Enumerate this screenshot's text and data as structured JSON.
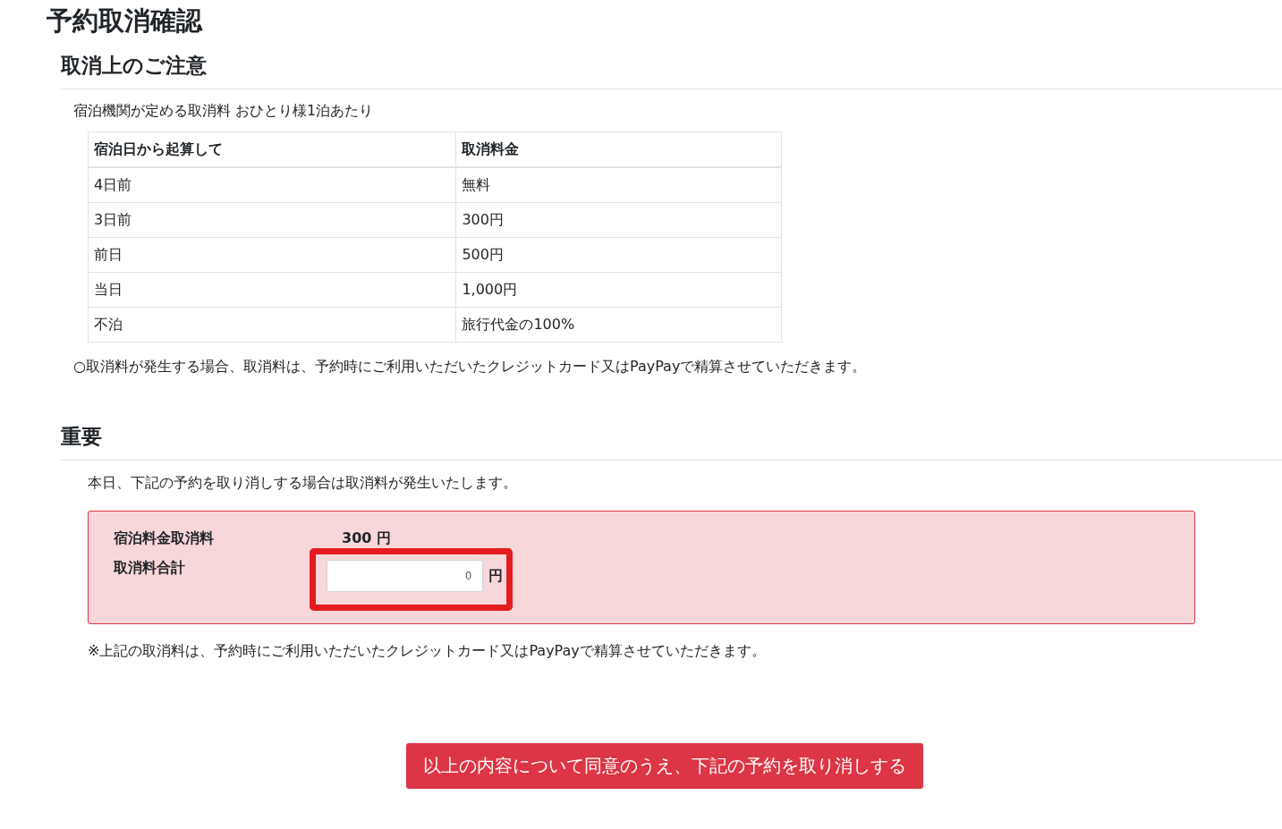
{
  "title": "予約取消確認",
  "notice": {
    "heading": "取消上のご注意",
    "intro": "宿泊機関が定める取消料  おひとり様1泊あたり",
    "table": {
      "columns": [
        "宿泊日から起算して",
        "取消料金"
      ],
      "rows": [
        [
          "4日前",
          "無料"
        ],
        [
          "3日前",
          "300円"
        ],
        [
          "前日",
          "500円"
        ],
        [
          "当日",
          "1,000円"
        ],
        [
          "不泊",
          "旅行代金の100%"
        ]
      ]
    },
    "note": "○取消料が発生する場合、取消料は、予約時にご利用いただいたクレジットカード又はPayPayで精算させていただきます。"
  },
  "important": {
    "heading": "重要",
    "message": "本日、下記の予約を取り消しする場合は取消料が発生いたします。",
    "fee_label": "宿泊料金取消料",
    "fee_value": "300 円",
    "total_label": "取消料合計",
    "total_value": "0",
    "total_unit": "円",
    "note": "※上記の取消料は、予約時にご利用いただいたクレジットカード又はPayPayで精算させていただきます。"
  },
  "confirm_button": "以上の内容について同意のうえ、下記の予約を取り消しする"
}
